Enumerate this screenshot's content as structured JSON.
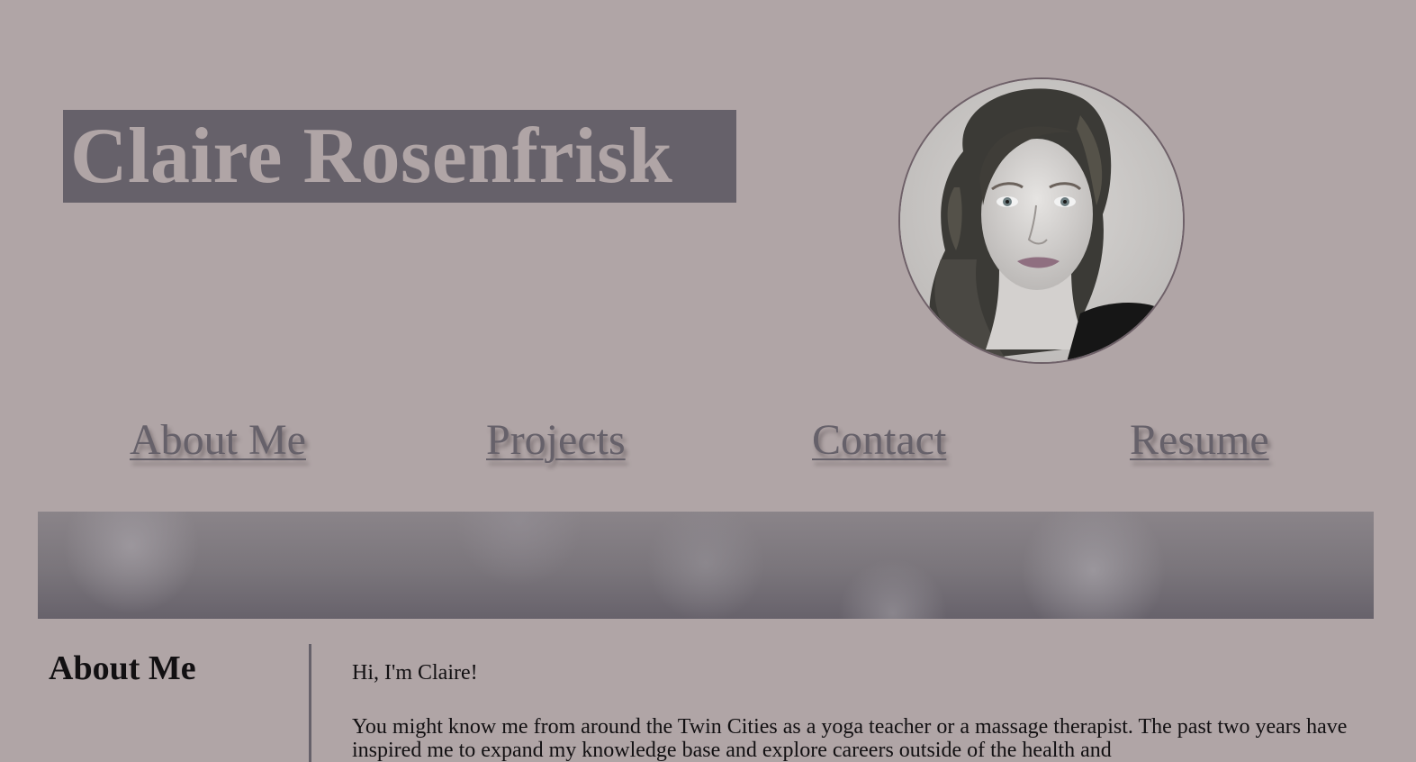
{
  "header": {
    "title": "Claire Rosenfrisk"
  },
  "profile": {
    "avatar_alt": "Claire Rosenfrisk"
  },
  "nav": {
    "items": [
      {
        "label": "About Me"
      },
      {
        "label": "Projects"
      },
      {
        "label": "Contact"
      },
      {
        "label": "Resume"
      }
    ]
  },
  "about": {
    "heading": "About Me",
    "greeting": "Hi, I'm Claire!",
    "paragraph": "You might know me from around the Twin Cities as a yoga teacher or a massage therapist. The past two years have inspired me to expand my knowledge base and explore careers outside of the health and"
  },
  "colors": {
    "background": "#b0a5a6",
    "title_block": "#66616a",
    "nav_link": "#66616a",
    "text": "#121012"
  }
}
